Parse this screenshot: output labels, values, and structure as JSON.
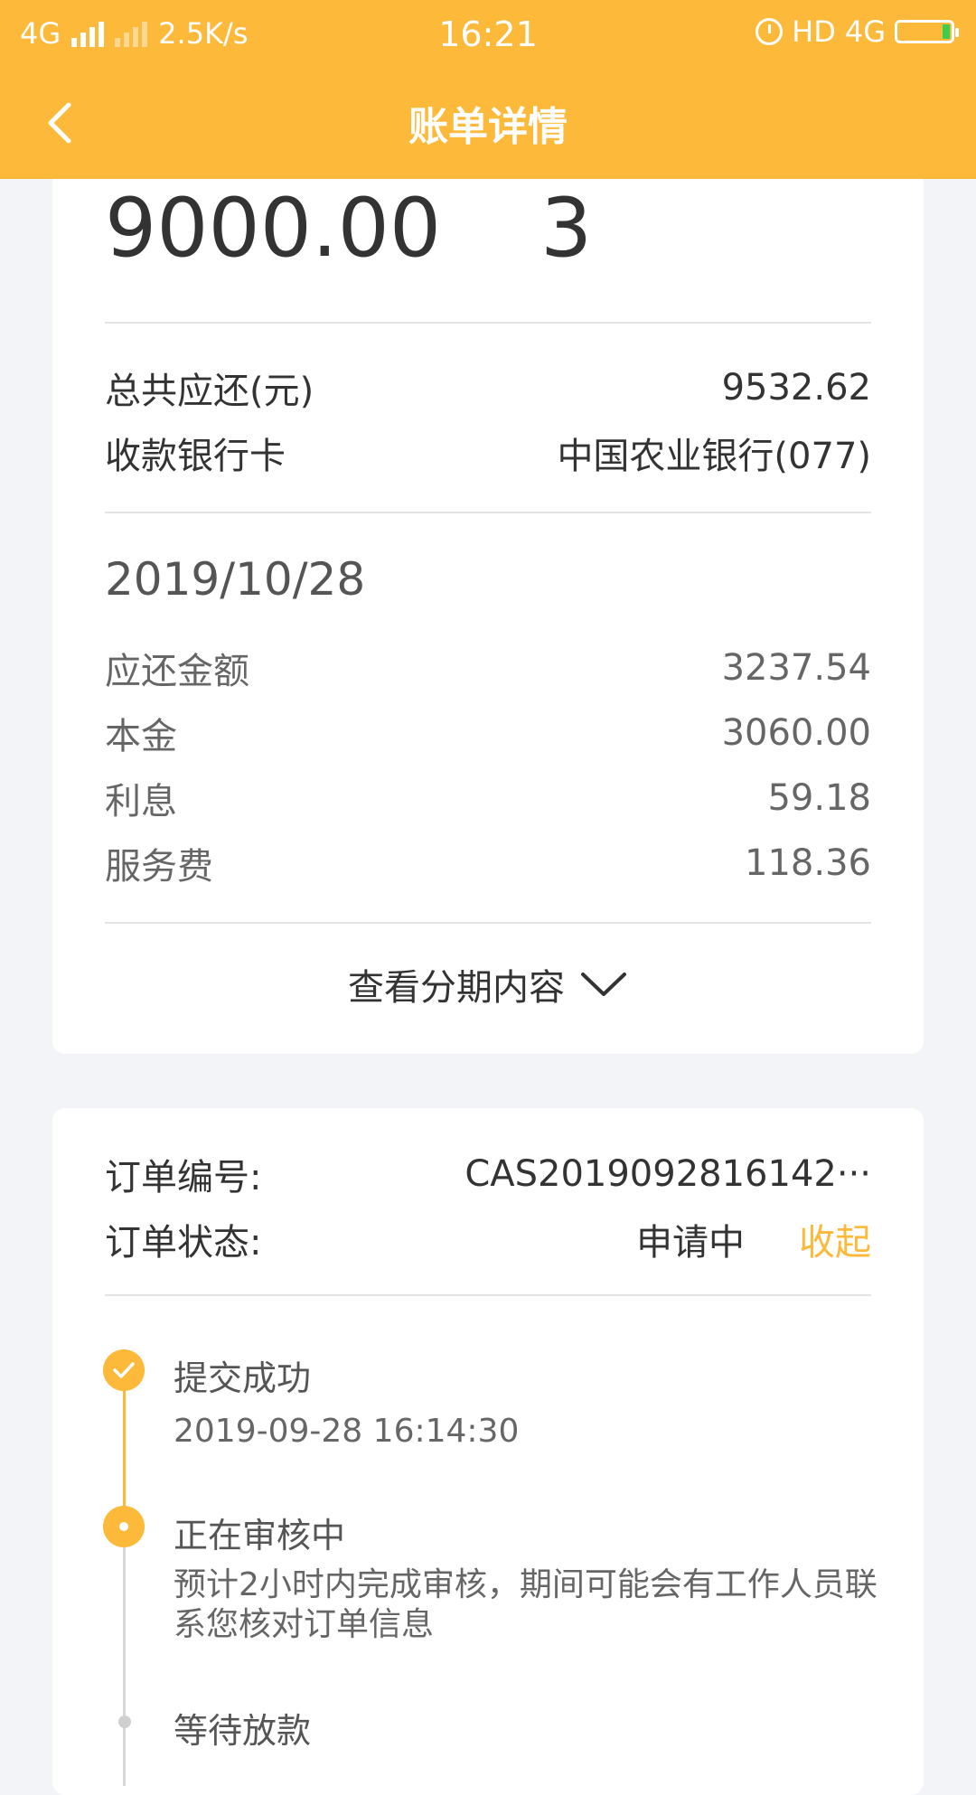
{
  "status_bar": {
    "network_left": "4G",
    "speed": "2.5K/s",
    "time": "16:21",
    "hd": "HD",
    "network_right": "4G"
  },
  "header": {
    "title": "账单详情",
    "back_icon": "chevron-left-icon"
  },
  "loan": {
    "amount": "9000.00",
    "term": "3",
    "total_label": "总共应还(元)",
    "total_value": "9532.62",
    "bank_label": "收款银行卡",
    "bank_value": "中国农业银行(077)"
  },
  "installment": {
    "date": "2019/10/28",
    "rows": [
      {
        "label": "应还金额",
        "value": "3237.54"
      },
      {
        "label": "本金",
        "value": "3060.00"
      },
      {
        "label": "利息",
        "value": "59.18"
      },
      {
        "label": "服务费",
        "value": "118.36"
      }
    ],
    "toggle_label": "查看分期内容"
  },
  "order": {
    "number_label": "订单编号:",
    "number_value": "CAS2019092816142···",
    "status_label": "订单状态:",
    "status_value": "申请中",
    "collapse_label": "收起"
  },
  "timeline": [
    {
      "title": "提交成功",
      "sub": "2019-09-28 16:14:30"
    },
    {
      "title": "正在审核中",
      "sub": "预计2小时内完成审核，期间可能会有工作人员联系您核对订单信息"
    },
    {
      "title": "等待放款",
      "sub": ""
    }
  ],
  "colors": {
    "accent": "#FDB93A",
    "background": "#f2f4f7"
  }
}
